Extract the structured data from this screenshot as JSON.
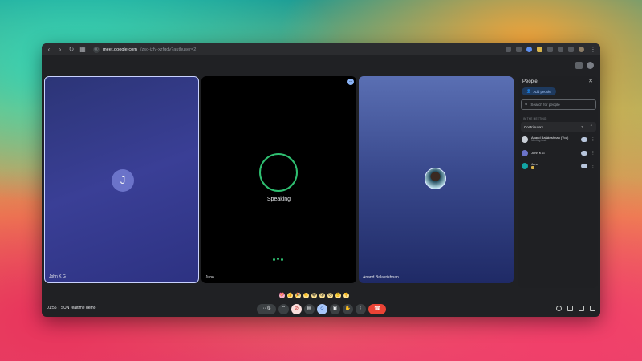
{
  "browser": {
    "url_host": "meet.google.com",
    "url_rest": "/zsc-izfv-xzfqdv?authuser=2"
  },
  "tiles": [
    {
      "name": "John K G",
      "initial": "J"
    },
    {
      "name": "Juno",
      "status": "Speaking"
    },
    {
      "name": "Anand Balakrishnan"
    }
  ],
  "people_panel": {
    "title": "People",
    "add_people_label": "Add people",
    "search_placeholder": "Search for people",
    "section_label": "IN THE MEETING",
    "group_label": "Contributors",
    "group_count": "3",
    "people": [
      {
        "name": "Anand Balakrishnan (You)",
        "subtitle": "Meeting host",
        "avatar_color": "#c9ced6"
      },
      {
        "name": "John K G",
        "avatar_color": "#6b73c9"
      },
      {
        "name": "Juno",
        "avatar_color": "#12a4a4"
      }
    ]
  },
  "reactions": [
    "💖",
    "👍",
    "🎉",
    "👏",
    "😂",
    "😮",
    "😢",
    "🤔",
    "👎"
  ],
  "meeting": {
    "time": "01:55",
    "title": "SUN realtime demo"
  },
  "colors": {
    "accent": "#a8c7fa",
    "speaking": "#2fbf71",
    "end_call": "#ea4335"
  }
}
